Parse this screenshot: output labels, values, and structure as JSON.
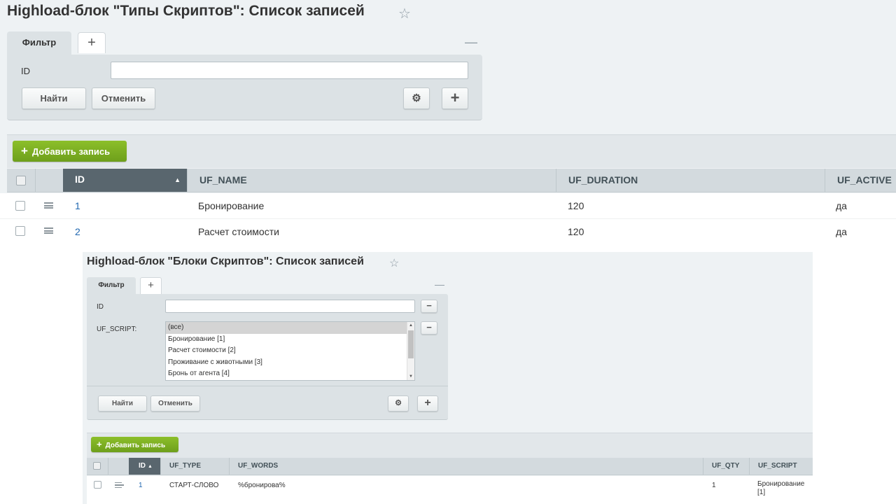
{
  "top_panel": {
    "title": "Highload-блок \"Типы Скриптов\": Список записей",
    "star_icon": "☆",
    "filter": {
      "tab_label": "Фильтр",
      "add_tab_icon": "+",
      "minimize_icon": "—",
      "fields": [
        {
          "label": "ID",
          "value": ""
        }
      ],
      "find_label": "Найти",
      "cancel_label": "Отменить",
      "settings_icon": "⚙",
      "add_icon": "+"
    },
    "add_record_label": "Добавить запись",
    "add_record_icon": "+",
    "table": {
      "columns": [
        "ID",
        "UF_NAME",
        "UF_DURATION",
        "UF_ACTIVE"
      ],
      "sort_icon": "▲",
      "rows": [
        {
          "id": "1",
          "name": "Бронирование",
          "duration": "120",
          "active": "да"
        },
        {
          "id": "2",
          "name": "Расчет стоимости",
          "duration": "120",
          "active": "да"
        }
      ]
    }
  },
  "bottom_panel": {
    "title": "Highload-блок \"Блоки Скриптов\": Список записей",
    "star_icon": "☆",
    "filter": {
      "tab_label": "Фильтр",
      "add_tab_icon": "+",
      "minimize_icon": "—",
      "id_label": "ID",
      "id_value": "",
      "script_label": "UF_SCRIPT:",
      "script_options": [
        "(все)",
        "Бронирование [1]",
        "Расчет стоимости [2]",
        "Проживание с животными [3]",
        "Бронь от агента [4]"
      ],
      "selected_option": "(все)",
      "remove_icon": "−",
      "find_label": "Найти",
      "cancel_label": "Отменить",
      "settings_icon": "⚙",
      "add_icon": "+"
    },
    "add_record_label": "Добавить запись",
    "add_record_icon": "+",
    "table": {
      "columns": [
        "ID",
        "UF_TYPE",
        "UF_WORDS",
        "UF_QTY",
        "UF_SCRIPT"
      ],
      "sort_icon": "▲",
      "rows": [
        {
          "id": "1",
          "type": "СТАРТ-СЛОВО",
          "words": "%бронирова%",
          "qty": "1",
          "script": "Бронирование [1]"
        }
      ]
    }
  }
}
